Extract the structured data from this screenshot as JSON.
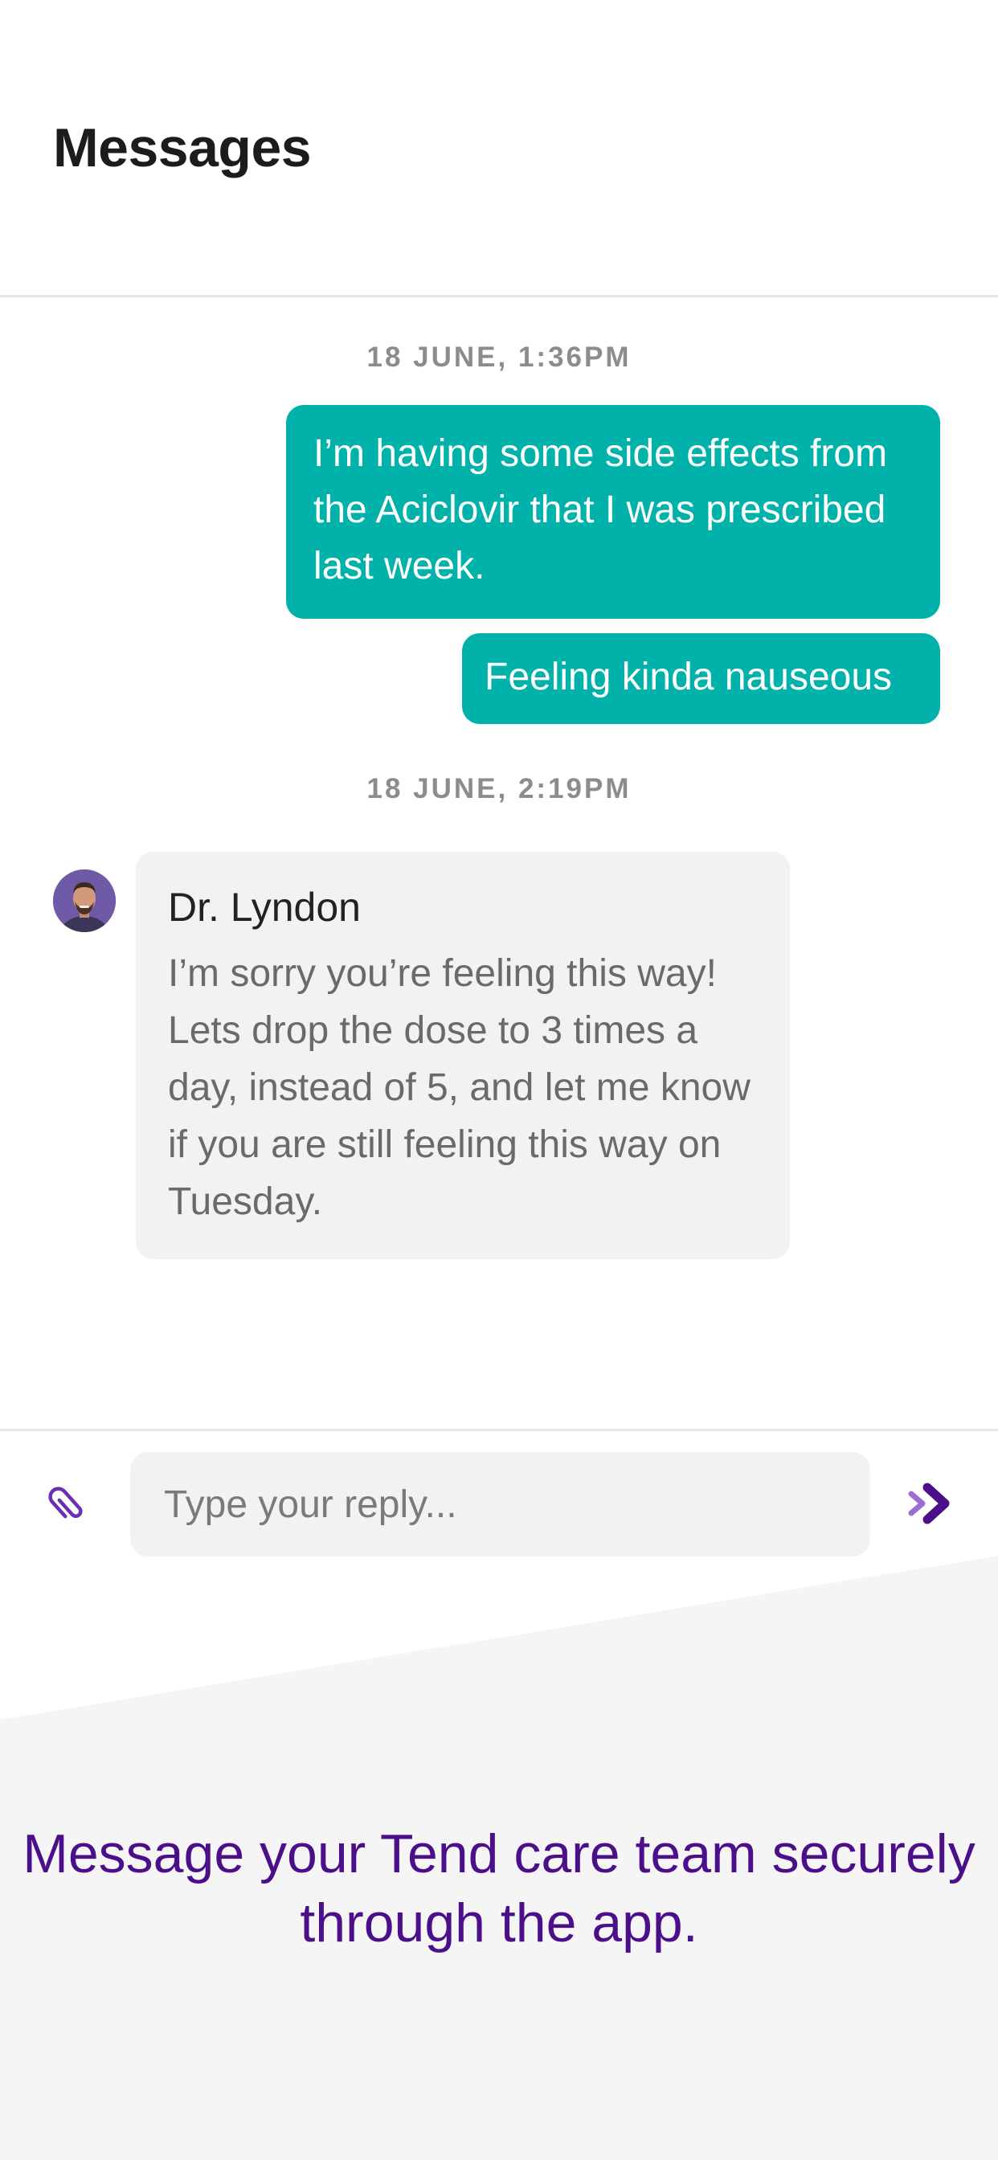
{
  "header": {
    "title": "Messages"
  },
  "conversation": {
    "groups": [
      {
        "timestamp": "18 JUNE, 1:36PM",
        "messages": [
          {
            "direction": "outgoing",
            "text": "I’m having some side effects from the Aciclovir that I was prescribed last week."
          },
          {
            "direction": "outgoing",
            "text": "Feeling kinda nauseous"
          }
        ]
      },
      {
        "timestamp": "18 JUNE, 2:19PM",
        "messages": [
          {
            "direction": "incoming",
            "sender": "Dr. Lyndon",
            "avatar": "doctor-avatar",
            "text": "I’m sorry you’re feeling this way! Lets drop the dose to 3 times a day, instead of 5, and let me know if you are still feeling this way on Tuesday."
          }
        ]
      }
    ]
  },
  "composer": {
    "placeholder": "Type your reply...",
    "value": "",
    "attach_icon": "paperclip-icon",
    "send_icon": "send-icon"
  },
  "promo": {
    "text": "Message your Tend care team securely through the app."
  },
  "colors": {
    "outgoing_bubble": "#00b2a9",
    "incoming_bubble": "#f2f2f4",
    "accent_purple": "#4b0f8a",
    "icon_purple": "#6b2fb3",
    "promo_background": "#f5f5f6"
  }
}
